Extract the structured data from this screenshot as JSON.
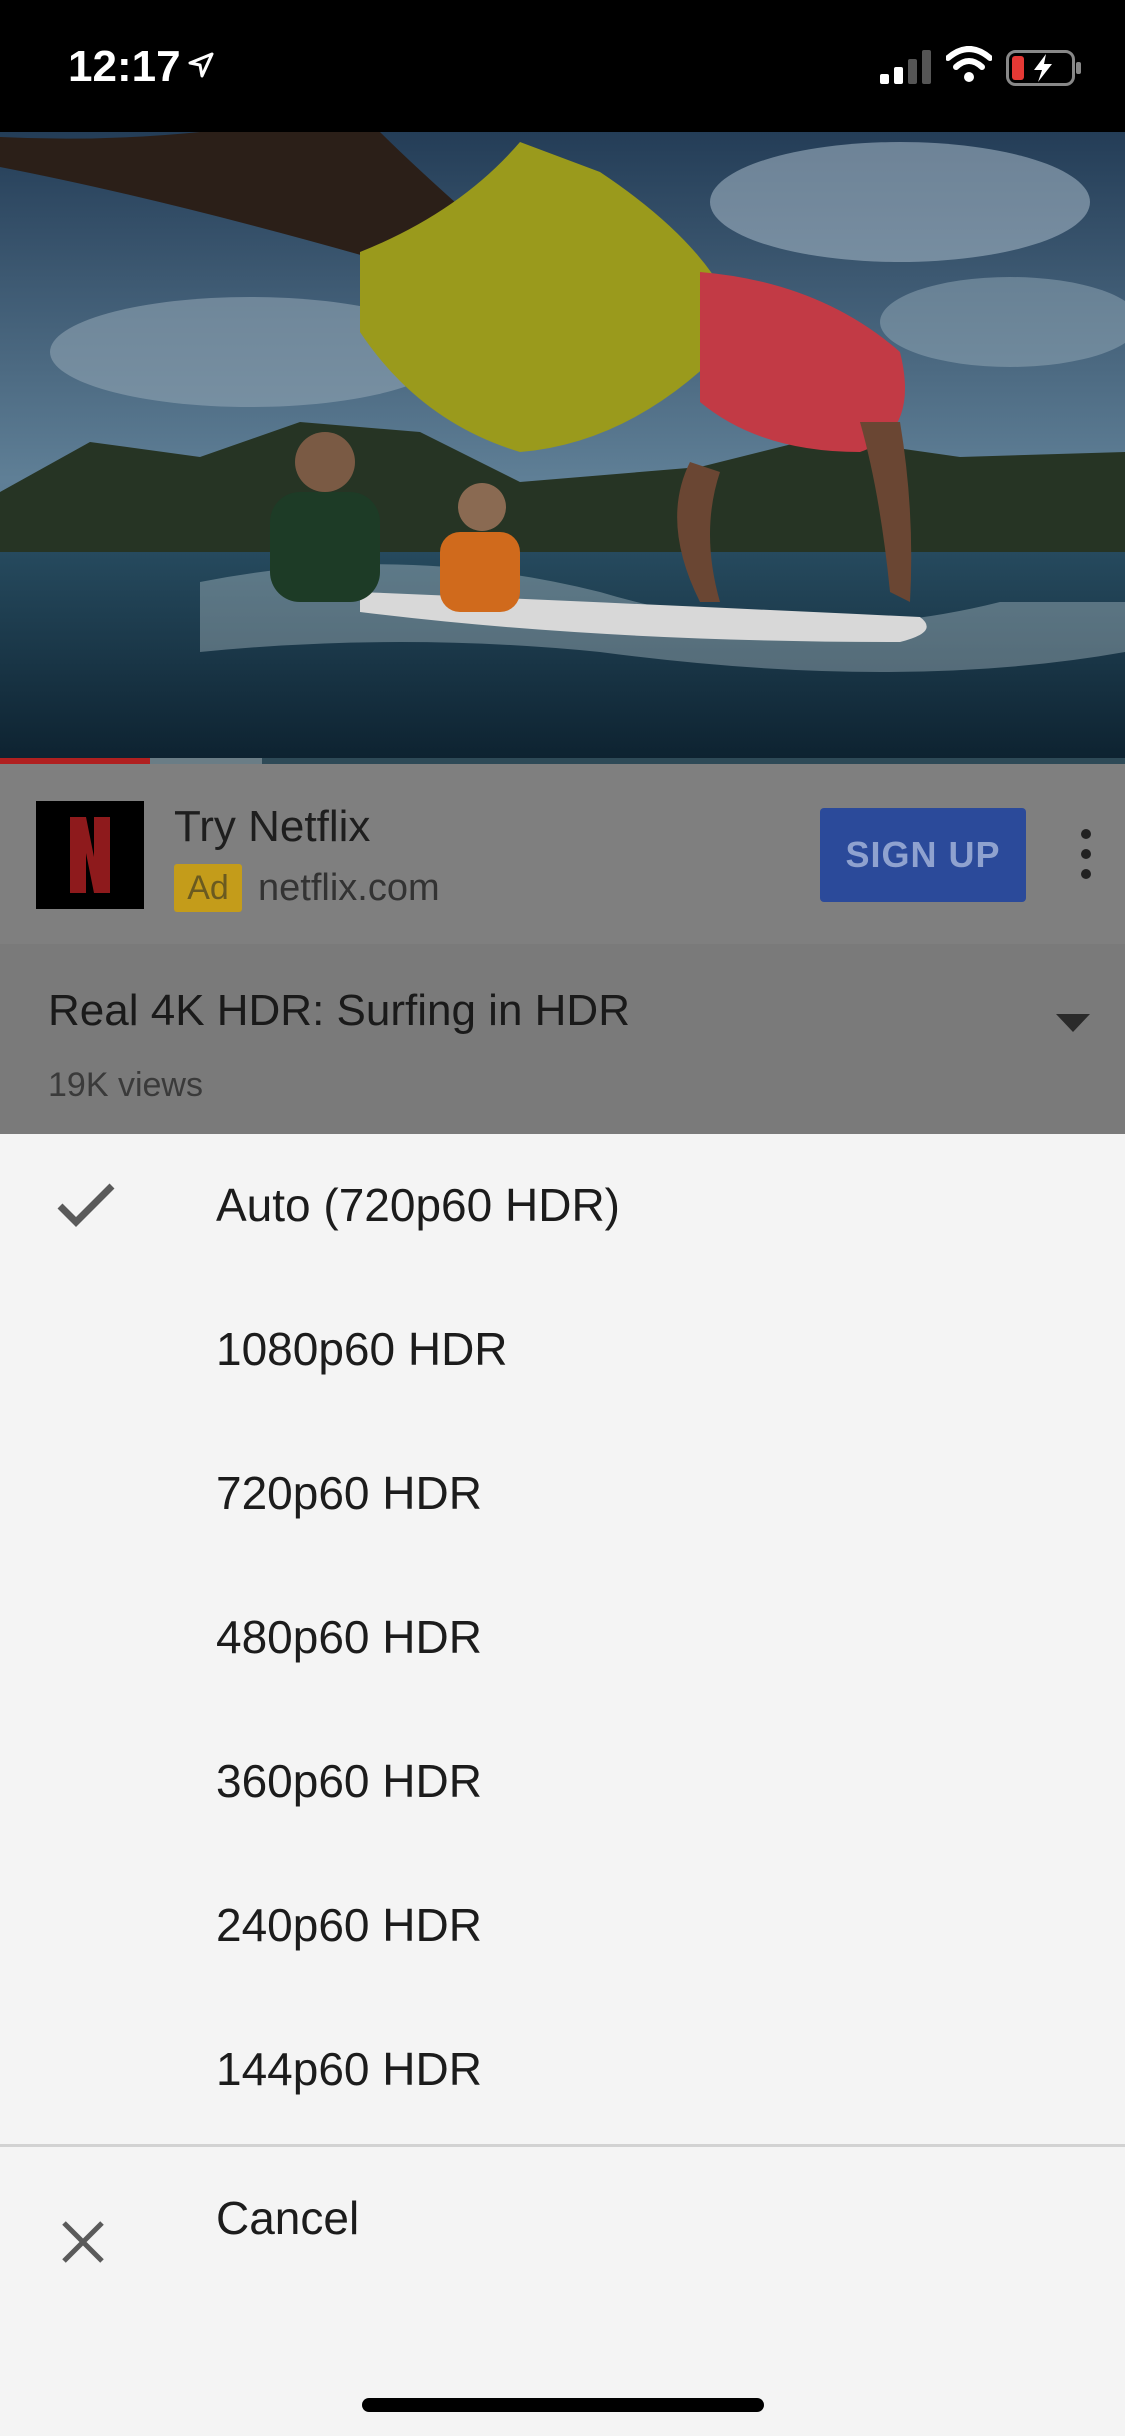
{
  "status_bar": {
    "time": "12:17"
  },
  "ad": {
    "title": "Try Netflix",
    "badge": "Ad",
    "url": "netflix.com",
    "cta": "SIGN UP",
    "logo_letter": "N"
  },
  "video": {
    "title": "Real 4K HDR: Surfing in HDR",
    "views": "19K views",
    "progress_played": 0.133,
    "progress_buffered": 0.233
  },
  "quality_menu": {
    "options": [
      {
        "label": "Auto (720p60 HDR)",
        "selected": true
      },
      {
        "label": "1080p60 HDR",
        "selected": false
      },
      {
        "label": "720p60 HDR",
        "selected": false
      },
      {
        "label": "480p60 HDR",
        "selected": false
      },
      {
        "label": "360p60 HDR",
        "selected": false
      },
      {
        "label": "240p60 HDR",
        "selected": false
      },
      {
        "label": "144p60 HDR",
        "selected": false
      }
    ],
    "cancel_label": "Cancel"
  },
  "icons": {
    "location": "location-arrow-icon",
    "signal": "signal-icon",
    "wifi": "wifi-icon",
    "battery": "battery-charging-icon",
    "more": "more-vert-icon",
    "dropdown": "chevron-down-icon",
    "check": "check-icon",
    "close": "close-icon"
  },
  "colors": {
    "brand_red": "#b02020",
    "signup_blue": "#2b4a9a",
    "ad_badge": "#c49c1a",
    "sheet_bg": "#f4f4f4"
  }
}
